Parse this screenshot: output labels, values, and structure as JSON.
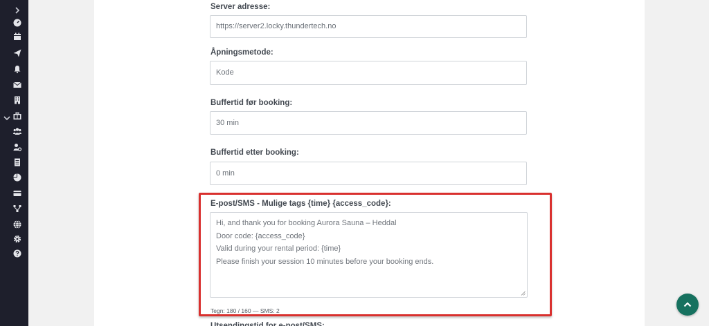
{
  "colors": {
    "sidebar_bg": "#1e1f2c",
    "highlight_border": "#d9302e",
    "scroll_button_bg": "#16715f"
  },
  "sidebar": {
    "expand_icon": "chevron-right-icon",
    "section_toggle_icon": "chevron-down-icon",
    "icons": [
      "dashboard-gauge-icon",
      "calendar-icon",
      "paper-plane-icon",
      "bell-icon",
      "envelope-icon",
      "building-icon",
      "locker-icon",
      "users-icon",
      "user-gear-icon",
      "document-icon",
      "pie-chart-icon",
      "credit-card-icon",
      "network-icon",
      "globe-icon",
      "gear-icon",
      "help-icon"
    ]
  },
  "form": {
    "server_address": {
      "label": "Server adresse:",
      "value": "https://server2.locky.thundertech.no"
    },
    "opening_method": {
      "label": "Åpningsmetode:",
      "value": "Kode"
    },
    "buffer_before": {
      "label": "Buffertid før booking:",
      "value": "30 min"
    },
    "buffer_after": {
      "label": "Buffertid etter booking:",
      "value": "0 min"
    },
    "template": {
      "label": "E-post/SMS - Mulige tags {time} {access_code}:",
      "lines": [
        "Hi, and thank you for booking Aurora Sauna – Heddal",
        "Door code: {access_code}",
        "Valid during your rental period: {time}",
        "Please finish your session 10 minutes before your booking ends."
      ],
      "counter": "Tegn: 180 / 160 — SMS: 2"
    },
    "next_label_partial": "Utsendingstid for e-post/SMS:"
  },
  "scroll_top_button": {
    "icon": "chevron-up-icon"
  }
}
